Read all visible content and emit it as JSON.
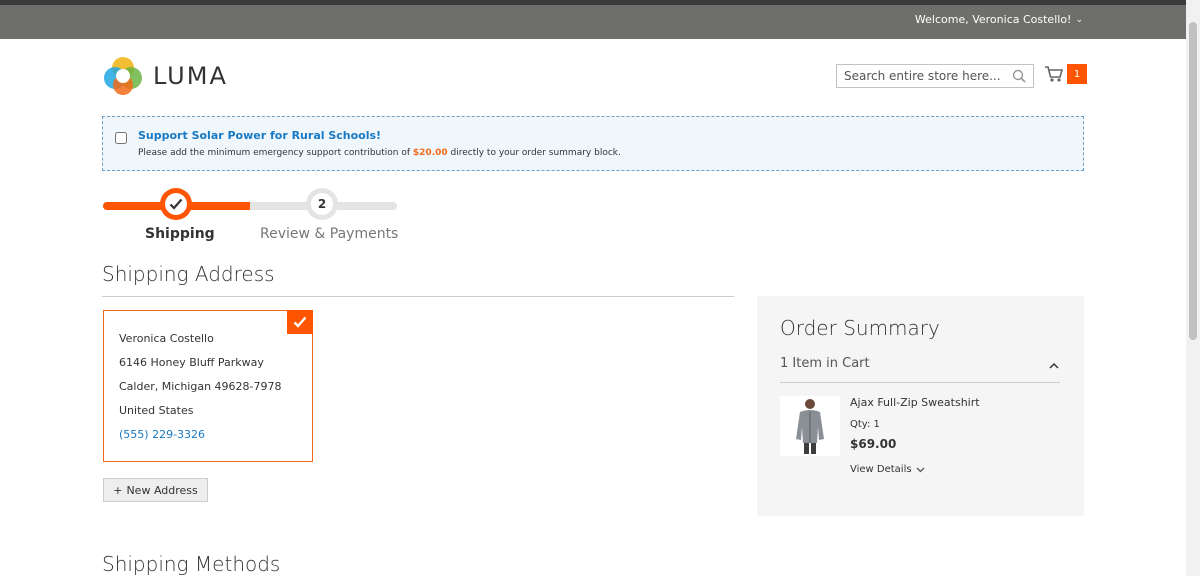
{
  "header": {
    "welcome": "Welcome, Veronica Costello!"
  },
  "logo": {
    "text": "LUMA"
  },
  "search": {
    "placeholder": "Search entire store here..."
  },
  "cart": {
    "count": "1"
  },
  "notice": {
    "title": "Support Solar Power for Rural Schools!",
    "desc_pre": "Please add the minimum emergency support contribution of ",
    "amount": "$20.00",
    "desc_post": " directly to your order summary block."
  },
  "steps": [
    {
      "label": "Shipping",
      "state": "complete"
    },
    {
      "label": "Review & Payments",
      "number": "2"
    }
  ],
  "progress": {
    "fraction": 0.5
  },
  "shipping_address": {
    "title": "Shipping Address",
    "name": "Veronica Costello",
    "street": "6146 Honey Bluff Parkway",
    "city": "Calder, Michigan 49628-7978",
    "country": "United States",
    "phone": "(555) 229-3326",
    "new_address_label": "New Address"
  },
  "shipping_methods": {
    "title": "Shipping Methods"
  },
  "order_summary": {
    "title": "Order Summary",
    "items_label": "1 Item in Cart",
    "product": {
      "name": "Ajax Full-Zip Sweatshirt",
      "qty": "Qty: 1",
      "price": "$69.00",
      "details_label": "View Details"
    }
  },
  "colors": {
    "accent": "#ff5501",
    "link": "#1979c3",
    "topbar": "#6e6e6b"
  }
}
